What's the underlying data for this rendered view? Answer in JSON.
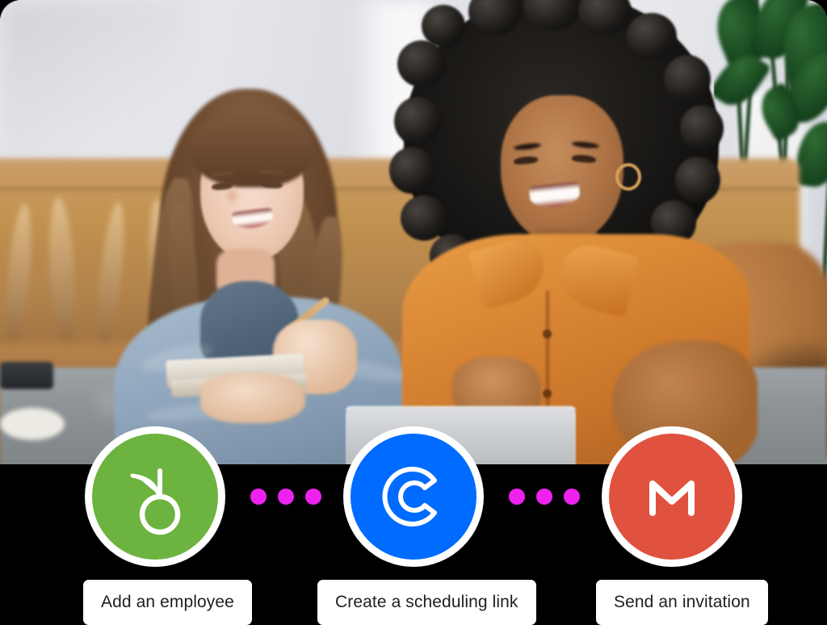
{
  "graphic": {
    "title": "Integration workflow illustration",
    "background_color": "#000000",
    "photo": {
      "alt": "Two women sitting on a tan leather couch, smiling while working together with a notebook and a laptop",
      "scene_elements": [
        "light-gray-wall",
        "tan-leather-sofa",
        "blurred-green-plant",
        "glass-coffee-table",
        "silver-laptop",
        "notebook-and-pen"
      ]
    }
  },
  "flow": {
    "nodes": [
      {
        "id": "bamboohr",
        "icon_name": "bamboohr-logo-icon",
        "brand_color": "#6DB33F",
        "glyph_color": "#FFFFFF",
        "label": "Add an employee"
      },
      {
        "id": "calendly",
        "icon_name": "calendly-logo-icon",
        "brand_color": "#006BFF",
        "glyph_color": "#FFFFFF",
        "label": "Create a scheduling link"
      },
      {
        "id": "gmail",
        "icon_name": "gmail-logo-icon",
        "brand_color": "#E0523F",
        "glyph_color": "#FFFFFF",
        "label": "Send an invitation"
      }
    ],
    "connectors": [
      {
        "id": "connector-1",
        "dot_count": 3,
        "dot_color": "#EE22EE"
      },
      {
        "id": "connector-2",
        "dot_count": 3,
        "dot_color": "#EE22EE"
      }
    ]
  }
}
